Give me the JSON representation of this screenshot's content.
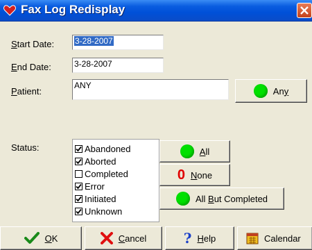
{
  "window": {
    "title": "Fax Log Redisplay",
    "icon": "heart-icon"
  },
  "form": {
    "start_date": {
      "label_first": "S",
      "label_rest": "tart Date:",
      "value": "3-28-2007"
    },
    "end_date": {
      "label_first": "E",
      "label_rest": "nd Date:",
      "value": "3-28-2007"
    },
    "patient": {
      "label_first": "P",
      "label_rest": "atient:",
      "value": "ANY"
    },
    "any_button": {
      "label_pre": "An",
      "label_u": "y",
      "label_post": ""
    },
    "status_label": "Status:"
  },
  "status_options": [
    {
      "label": "Abandoned",
      "checked": true
    },
    {
      "label": "Aborted",
      "checked": true
    },
    {
      "label": "Completed",
      "checked": false
    },
    {
      "label": "Error",
      "checked": true
    },
    {
      "label": "Initiated",
      "checked": true
    },
    {
      "label": "Unknown",
      "checked": true
    }
  ],
  "status_buttons": {
    "all": {
      "label_u": "A",
      "label_post": "ll"
    },
    "none": {
      "label_u": "N",
      "label_post": "one",
      "glyph": "0"
    },
    "all_but_completed": {
      "label_pre": "All ",
      "label_u": "B",
      "label_post": "ut Completed"
    }
  },
  "bottom_buttons": {
    "ok": {
      "label_u": "O",
      "label_post": "K"
    },
    "cancel": {
      "label_u": "C",
      "label_post": "ancel"
    },
    "help": {
      "label_u": "H",
      "label_post": "elp"
    },
    "calendar": {
      "label": "Calendar"
    }
  },
  "colors": {
    "titlebar": "#0a5de0",
    "green_indicator": "#00e000",
    "red_zero": "#e00000",
    "selection": "#316ac5"
  }
}
